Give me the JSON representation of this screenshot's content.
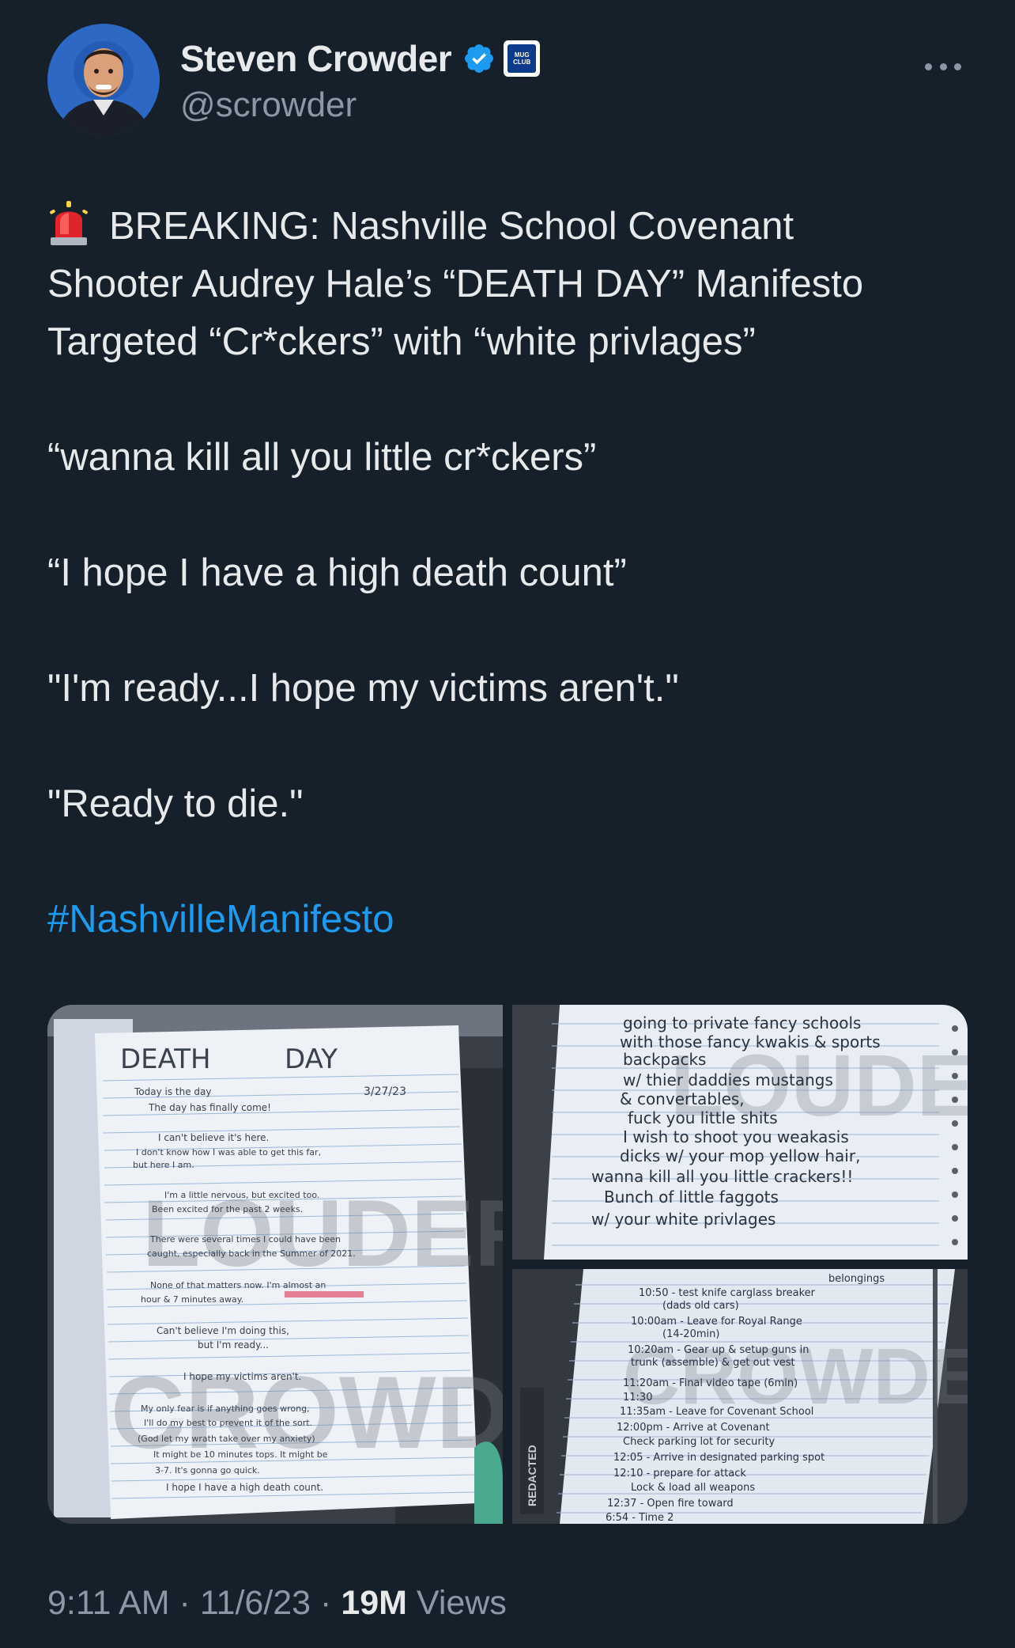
{
  "author": {
    "display_name": "Steven Crowder",
    "handle": "@scrowder",
    "verified": true,
    "affiliate_badge_text": [
      "MUG",
      "CLUB"
    ],
    "avatar_icon": "profile-photo",
    "more_icon": "ellipsis-icon"
  },
  "tweet": {
    "headline_icon": "police-siren-icon",
    "lines": [
      "BREAKING: Nashville School Covenant",
      "Shooter Audrey Hale’s “DEATH DAY” Manifesto",
      "Targeted “Cr*ckers” with “white privlages”"
    ],
    "quotes": [
      "“wanna kill all you little cr*ckers”",
      "“I hope I have a high death count”",
      "\"I'm ready...I hope my victims aren't.\"",
      "\"Ready to die.\""
    ],
    "hashtag": "#NashvilleManifesto"
  },
  "media": {
    "images": [
      {
        "alt": "Handwritten notebook page titled DEATH DAY",
        "watermark": "LOUDER CROWDER",
        "text_lines": [
          "DEATH DAY",
          "3/27/23",
          "Today is the day",
          "The day has finally come!",
          "I can't believe it's here.",
          "I don't know how I was able to get this far,",
          "but here I am.",
          "I'm a little nervous, but excited too.",
          "Been excited for the past 2 weeks.",
          "There were several times I could have been",
          "caught, especially back in the Summer of 2021.",
          "None of that matters now. I'm almost an",
          "hour & 7 minutes away.",
          "Can't believe I'm doing this,",
          "but I'm ready...",
          "I hope my victims aren't.",
          "My only fear is if anything goes wrong,",
          "I'll do my best to prevent it of the sort.",
          "(God let my wrath take over my anxiety)",
          "It might be 10 minutes tops. It might be",
          "3-7. It's gonna go quick.",
          "I hope I have a high death count."
        ]
      },
      {
        "alt": "Handwritten notebook page",
        "watermark": "LOUDER CROWDER",
        "text_lines": [
          "going to private fancy schools",
          "with those fancy kwakis & sports",
          "backpacks",
          "w/ thier daddies mustangs",
          "& convertables,",
          "fuck you little shits",
          "I wish to shoot you weakasis",
          "dicks w/ your mop yellow hair,",
          "wanna kill all you little crackers!!",
          "Bunch of little faggots",
          "w/ your white privlages"
        ]
      },
      {
        "alt": "Handwritten schedule on notebook page",
        "watermark": "LOUDER CROWDER",
        "redacted_label": "REDACTED",
        "text_lines": [
          "belongings",
          "10:50 - test knife carglass breaker",
          "(dads old cars)",
          "10:00am - Leave for Royal Range",
          "(14-20min)",
          "10:20am - Gear up & setup guns in",
          "trunk (assemble) & get out vest",
          "11:20am - Final video tape (6min)",
          "11:30",
          "11:35am - Leave for Covenant School",
          "12:00pm - Arrive at Covenant",
          "Check parking lot for security",
          "12:05 - Arrive in designated parking spot",
          "12:10 - prepare for attack",
          "Lock & load all weapons",
          "12:37 - Open fire toward",
          "6:54 - Time 2"
        ]
      }
    ]
  },
  "footer": {
    "time": "9:11 AM",
    "date": "11/6/23",
    "separator": "·",
    "views_count": "19M",
    "views_label": "Views"
  },
  "colors": {
    "background": "#15202b",
    "text": "#e7e9ea",
    "secondary": "#8b98a5",
    "link": "#1d9bf0",
    "verified": "#1d9bf0"
  }
}
